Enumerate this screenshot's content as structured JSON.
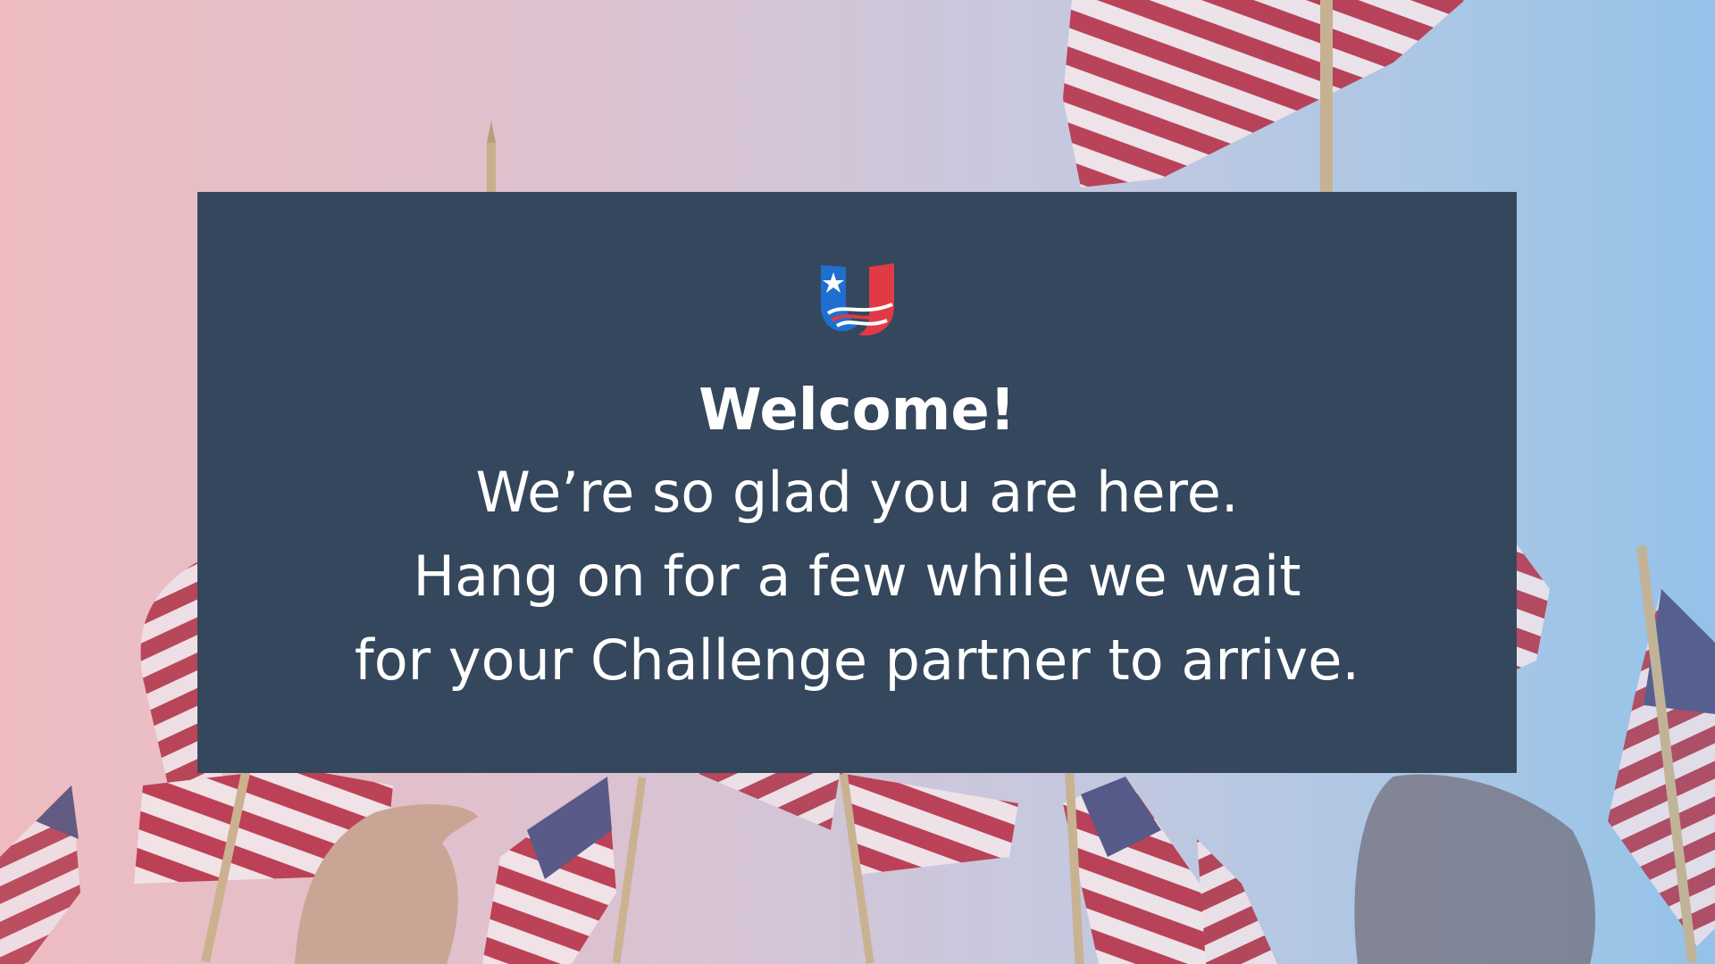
{
  "screen": {
    "background_top_left_color": "#eebcc0",
    "background_right_color": "#94c2e8",
    "background_image": "waving-american-flags-photo"
  },
  "card": {
    "color": "#34475c",
    "logo": {
      "icon": "flag-u-logo-icon",
      "blue": "#1f6fd1",
      "red": "#e03a45"
    },
    "welcome": "Welcome!",
    "lines": [
      "We’re so glad you are here.",
      "Hang on for a few while we wait",
      "for your Challenge partner to arrive."
    ]
  }
}
